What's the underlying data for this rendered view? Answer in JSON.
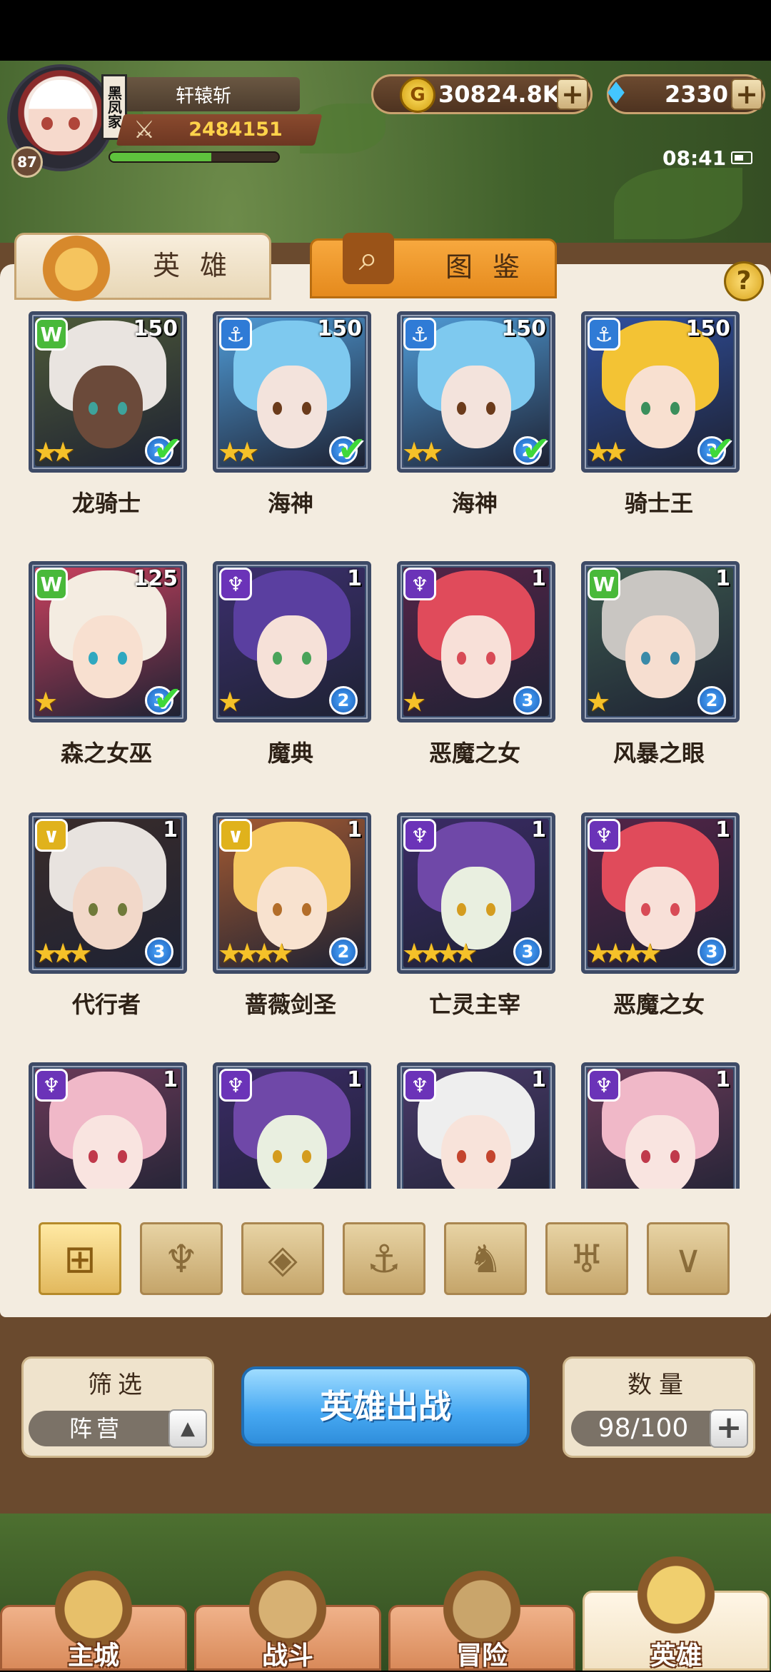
{
  "player": {
    "name": "轩辕斩",
    "level": "87",
    "guild_tag": "黑凤家",
    "power": "2484151",
    "exp_fraction": 0.6
  },
  "resources": {
    "gold": "30824.8K",
    "gems": "2330"
  },
  "status": {
    "time": "08:41"
  },
  "tabs": {
    "heroes": "英 雄",
    "codex": "图 鉴"
  },
  "icons": {
    "help": "?",
    "add": "+",
    "power": "crossed-swords",
    "gold": "G",
    "gem": "diamond"
  },
  "faction_colors": {
    "green": "#49b93a",
    "blue": "#2f7bd6",
    "purple": "#6b33b8",
    "gold": "#e0b21c"
  },
  "heroes": [
    {
      "name": "龙骑士",
      "level": "150",
      "faction": "green",
      "stars": 2,
      "rank": "2",
      "deployed": true,
      "hair": "#e9e4e0",
      "skin": "#6b4a3a",
      "eye": "#3ea39b",
      "bg": "#4e5a38"
    },
    {
      "name": "海神",
      "level": "150",
      "faction": "blue",
      "stars": 2,
      "rank": "2",
      "deployed": true,
      "hair": "#7ec9ef",
      "skin": "#f3e3dc",
      "eye": "#6b3b1b",
      "bg": "#4f9bd6"
    },
    {
      "name": "海神",
      "level": "150",
      "faction": "blue",
      "stars": 2,
      "rank": "2",
      "deployed": true,
      "hair": "#7ec9ef",
      "skin": "#f3e3dc",
      "eye": "#6b3b1b",
      "bg": "#4f9bd6"
    },
    {
      "name": "骑士王",
      "level": "150",
      "faction": "blue",
      "stars": 2,
      "rank": "3",
      "deployed": true,
      "hair": "#f3c334",
      "skin": "#f8e0d0",
      "eye": "#3b8f5c",
      "bg": "#2f4f9e"
    },
    {
      "name": "森之女巫",
      "level": "125",
      "faction": "green",
      "stars": 1,
      "rank": "3",
      "deployed": true,
      "hair": "#f4ece1",
      "skin": "#f8e0d0",
      "eye": "#2fa8c0",
      "bg": "#c9415e"
    },
    {
      "name": "魔典",
      "level": "1",
      "faction": "purple",
      "stars": 1,
      "rank": "2",
      "deployed": false,
      "hair": "#5a3fa0",
      "skin": "#f6e1d8",
      "eye": "#4aa35a",
      "bg": "#3c2f6e"
    },
    {
      "name": "恶魔之女",
      "level": "1",
      "faction": "purple",
      "stars": 1,
      "rank": "3",
      "deployed": false,
      "hair": "#e04b5b",
      "skin": "#f8e0d8",
      "eye": "#d84b56",
      "bg": "#552448"
    },
    {
      "name": "风暴之眼",
      "level": "1",
      "faction": "green",
      "stars": 1,
      "rank": "2",
      "deployed": false,
      "hair": "#c9c6c2",
      "skin": "#f6ded0",
      "eye": "#3a8aa8",
      "bg": "#3c5a4e"
    },
    {
      "name": "代行者",
      "level": "1",
      "faction": "gold",
      "stars": 3,
      "rank": "3",
      "deployed": false,
      "hair": "#e8e3df",
      "skin": "#f2d8c9",
      "eye": "#6f7a3a",
      "bg": "#3a2c2a"
    },
    {
      "name": "蔷薇剑圣",
      "level": "1",
      "faction": "gold",
      "stars": 4,
      "rank": "2",
      "deployed": false,
      "hair": "#f4c760",
      "skin": "#f8e2cf",
      "eye": "#b36e2a",
      "bg": "#a45a32"
    },
    {
      "name": "亡灵主宰",
      "level": "1",
      "faction": "purple",
      "stars": 4,
      "rank": "3",
      "deployed": false,
      "hair": "#6f48a8",
      "skin": "#e9efe0",
      "eye": "#d49c1f",
      "bg": "#3b2b66"
    },
    {
      "name": "恶魔之女",
      "level": "1",
      "faction": "purple",
      "stars": 4,
      "rank": "3",
      "deployed": false,
      "hair": "#e04b5b",
      "skin": "#f8e0d8",
      "eye": "#d84b56",
      "bg": "#552448"
    },
    {
      "name": "",
      "level": "1",
      "faction": "purple",
      "stars": 0,
      "rank": "",
      "deployed": false,
      "hair": "#f0b8c8",
      "skin": "#f9e4e0",
      "eye": "#c0394b",
      "bg": "#6a3a58"
    },
    {
      "name": "",
      "level": "1",
      "faction": "purple",
      "stars": 0,
      "rank": "",
      "deployed": false,
      "hair": "#6f48a8",
      "skin": "#e9efe0",
      "eye": "#d49c1f",
      "bg": "#3b2b66"
    },
    {
      "name": "",
      "level": "1",
      "faction": "purple",
      "stars": 0,
      "rank": "",
      "deployed": false,
      "hair": "#eeeeee",
      "skin": "#f8e3da",
      "eye": "#c4452e",
      "bg": "#4a3a6a"
    },
    {
      "name": "",
      "level": "1",
      "faction": "purple",
      "stars": 0,
      "rank": "",
      "deployed": false,
      "hair": "#f0b8c8",
      "skin": "#f9e4e0",
      "eye": "#c0394b",
      "bg": "#6a3a58"
    }
  ],
  "filters": [
    {
      "name": "all",
      "icon": "grid-icon",
      "glyph": "⊞",
      "active": true
    },
    {
      "name": "fire",
      "icon": "flame-icon",
      "glyph": "♆",
      "active": false
    },
    {
      "name": "rhombus",
      "icon": "rhombus-icon",
      "glyph": "◈",
      "active": false
    },
    {
      "name": "anchor",
      "icon": "anchor-icon",
      "glyph": "⚓",
      "active": false
    },
    {
      "name": "beast",
      "icon": "beast-icon",
      "glyph": "♞",
      "active": false
    },
    {
      "name": "demon",
      "icon": "horns-icon",
      "glyph": "♅",
      "active": false
    },
    {
      "name": "wing",
      "icon": "chevron-icon",
      "glyph": "∨",
      "active": false
    }
  ],
  "controls": {
    "filter_title": "筛选",
    "faction_label": "阵营",
    "deploy": "英雄出战",
    "count_title": "数量",
    "count_value": "98/100"
  },
  "nav": [
    {
      "label": "主城",
      "icon": "castle-icon",
      "active": false
    },
    {
      "label": "战斗",
      "icon": "swords-icon",
      "active": false
    },
    {
      "label": "冒险",
      "icon": "scroll-icon",
      "active": false
    },
    {
      "label": "英雄",
      "icon": "helmet-icon",
      "active": true
    }
  ]
}
